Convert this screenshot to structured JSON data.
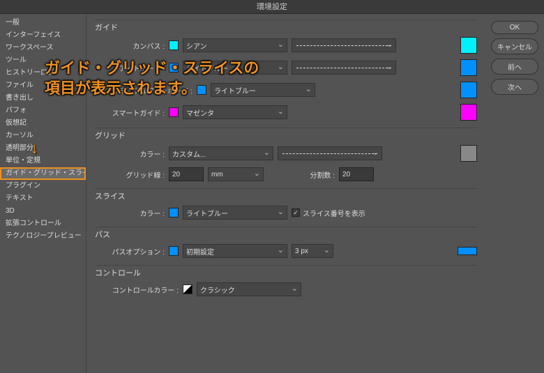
{
  "title": "環境設定",
  "sidebar": {
    "items": [
      {
        "label": "一般"
      },
      {
        "label": "インターフェイス"
      },
      {
        "label": "ワークスペース"
      },
      {
        "label": "ツール"
      },
      {
        "label": "ヒストリーログ"
      },
      {
        "label": "ファイル"
      },
      {
        "label": "書き出し"
      },
      {
        "label": "パフォ"
      },
      {
        "label": "仮想記"
      },
      {
        "label": "カーソル"
      },
      {
        "label": "透明部分"
      },
      {
        "label": "単位・定規"
      },
      {
        "label": "ガイド・グリッド・スライス"
      },
      {
        "label": "プラグイン"
      },
      {
        "label": "テキスト"
      },
      {
        "label": "3D"
      },
      {
        "label": "拡張コントロール"
      },
      {
        "label": "テクノロジープレビュー"
      }
    ],
    "active_index": 12
  },
  "buttons": {
    "ok": "OK",
    "cancel": "キャンセル",
    "prev": "前へ",
    "next": "次へ"
  },
  "sections": {
    "guide": {
      "title": "ガイド",
      "canvas_label": "カンバス :",
      "canvas_value": "シアン",
      "canvas_color": "#00f0ff",
      "artboard_label": "アートボード :",
      "artboard_value": "ライトブルー",
      "artboard_color": "#0090ff",
      "inactive_label": "非アクティブなアートボード :",
      "inactive_value": "ライトブルー",
      "inactive_color": "#0090ff",
      "smart_label": "スマートガイド :",
      "smart_value": "マゼンタ",
      "smart_color": "#ff00ff"
    },
    "grid": {
      "title": "グリッド",
      "color_label": "カラー :",
      "color_value": "カスタム...",
      "grid_color": "#888888",
      "line_label": "グリッド線 :",
      "line_value": "20",
      "unit_value": "mm",
      "subdiv_label": "分割数 :",
      "subdiv_value": "20"
    },
    "slice": {
      "title": "スライス",
      "color_label": "カラー :",
      "color_value": "ライトブルー",
      "slice_color": "#0090ff",
      "checkbox_label": "スライス番号を表示",
      "checked": true
    },
    "path": {
      "title": "パス",
      "option_label": "パスオプション :",
      "option_value": "初期設定",
      "width_value": "3 px",
      "swatch_color": "#0090ff"
    },
    "control": {
      "title": "コントロール",
      "color_label": "コントロールカラー :",
      "color_value": "クラシック"
    }
  },
  "annotation": {
    "line1": "ガイド・グリッド・スライスの",
    "line2": "項目が表示されます。",
    "arrow": "↓"
  }
}
